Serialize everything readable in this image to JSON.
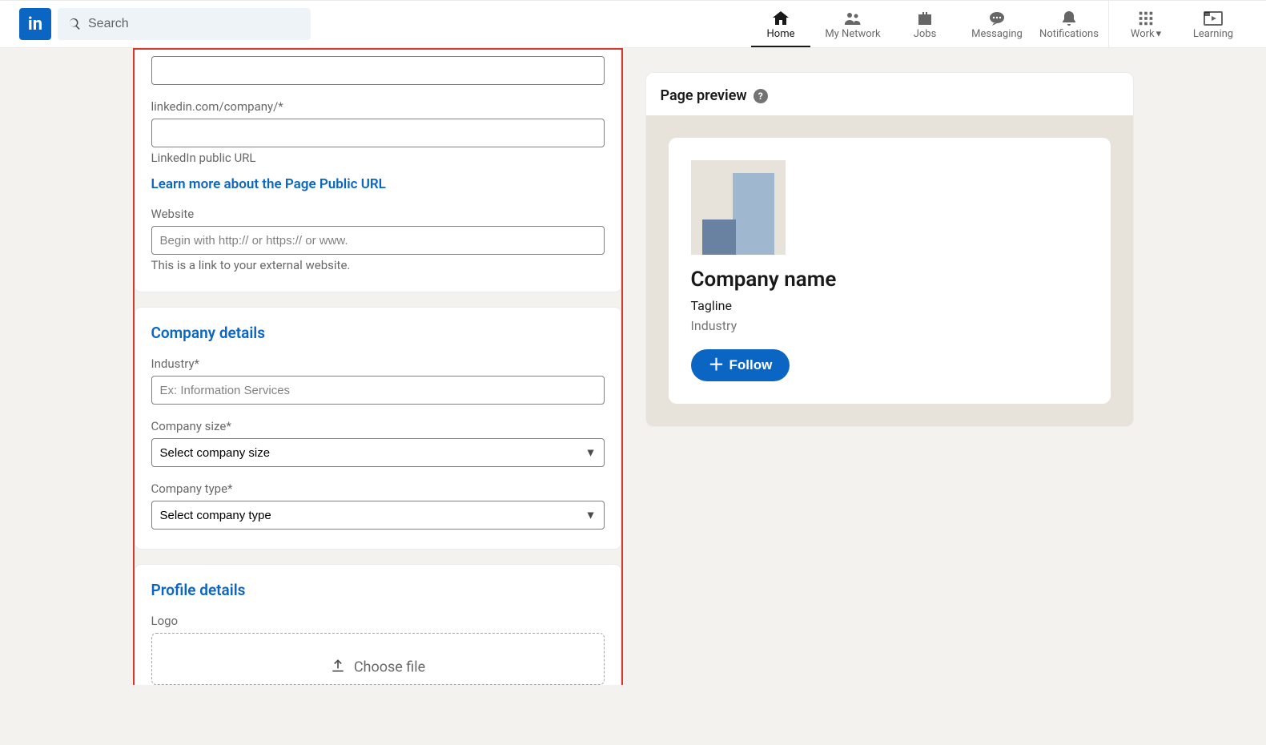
{
  "nav": {
    "search_placeholder": "Search",
    "items": [
      {
        "label": "Home"
      },
      {
        "label": "My Network"
      },
      {
        "label": "Jobs"
      },
      {
        "label": "Messaging"
      },
      {
        "label": "Notifications"
      }
    ],
    "work_label": "Work",
    "learning_label": "Learning"
  },
  "form": {
    "url_prefix_label": "linkedin.com/company/*",
    "url_help": "LinkedIn public URL",
    "url_learn_more": "Learn more about the Page Public URL",
    "website_label": "Website",
    "website_placeholder": "Begin with http:// or https:// or www.",
    "website_help": "This is a link to your external website.",
    "details_title": "Company details",
    "industry_label": "Industry*",
    "industry_placeholder": "Ex: Information Services",
    "size_label": "Company size*",
    "size_placeholder": "Select company size",
    "type_label": "Company type*",
    "type_placeholder": "Select company type",
    "profile_title": "Profile details",
    "logo_label": "Logo",
    "choose_file": "Choose file"
  },
  "preview": {
    "title": "Page preview",
    "company_name": "Company name",
    "tagline": "Tagline",
    "industry": "Industry",
    "follow": "Follow"
  }
}
